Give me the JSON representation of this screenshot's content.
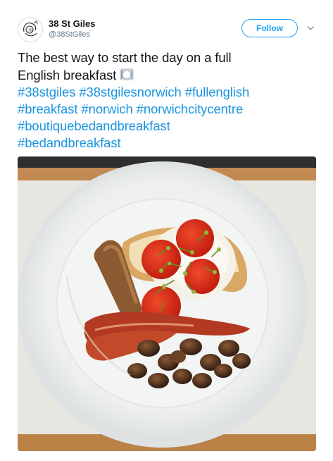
{
  "account": {
    "display_name": "38 St Giles",
    "handle": "@38StGiles",
    "avatar_icon": "38-st-giles-logo"
  },
  "follow_button": {
    "label": "Follow"
  },
  "more_menu_icon": "chevron-down-icon",
  "tweet": {
    "text_line_1": "The best way to start the day on a full",
    "text_line_2": "English breakfast",
    "emoji": "fork-and-knife-with-plate",
    "hashtags": [
      "#38stgiles",
      "#38stgilesnorwich",
      "#fullenglish",
      "#breakfast",
      "#norwich",
      "#norwichcitycentre",
      "#boutiquebedandbreakfast",
      "#bedandbreakfast"
    ]
  },
  "media": {
    "type": "photo",
    "subject": "full-english-breakfast-plate"
  },
  "colors": {
    "link": "#1b95e0",
    "follow_border": "#1da1f2",
    "text": "#14171a",
    "secondary_text": "#657786"
  }
}
